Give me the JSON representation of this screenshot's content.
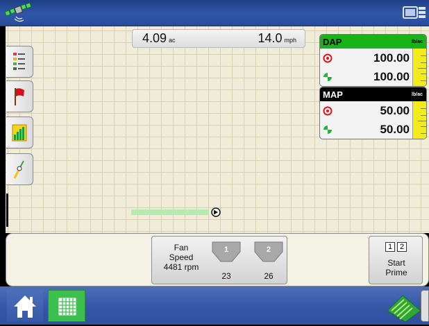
{
  "status": {
    "area_value": "4.09",
    "area_unit": "ac",
    "speed_value": "14.0",
    "speed_unit": "mph"
  },
  "side_tabs": [
    {
      "icon": "legend-list-icon"
    },
    {
      "icon": "red-flag-icon"
    },
    {
      "icon": "performance-chart-icon"
    },
    {
      "icon": "guidance-icon"
    }
  ],
  "products": [
    {
      "name": "DAP",
      "unit": "lb/ac",
      "header_color": "#18b319",
      "target_rate": "100.00",
      "applied_rate": "100.00"
    },
    {
      "name": "MAP",
      "unit": "lb/ac",
      "header_color": "#000000",
      "target_rate": "50.00",
      "applied_rate": "50.00"
    }
  ],
  "fan": {
    "label_line1": "Fan",
    "label_line2": "Speed",
    "rpm": "4481 rpm"
  },
  "tanks": [
    {
      "number": "1",
      "value": "23"
    },
    {
      "number": "2",
      "value": "26"
    }
  ],
  "prime": {
    "section_1": "1",
    "section_2": "2",
    "label_line1": "Start",
    "label_line2": "Prime"
  },
  "colors": {
    "accent_green": "#3bbf4f",
    "bar_blue": "#2f57a8",
    "coverage_green": "#b6ecb0",
    "rate_yellow": "#f4ec19"
  }
}
